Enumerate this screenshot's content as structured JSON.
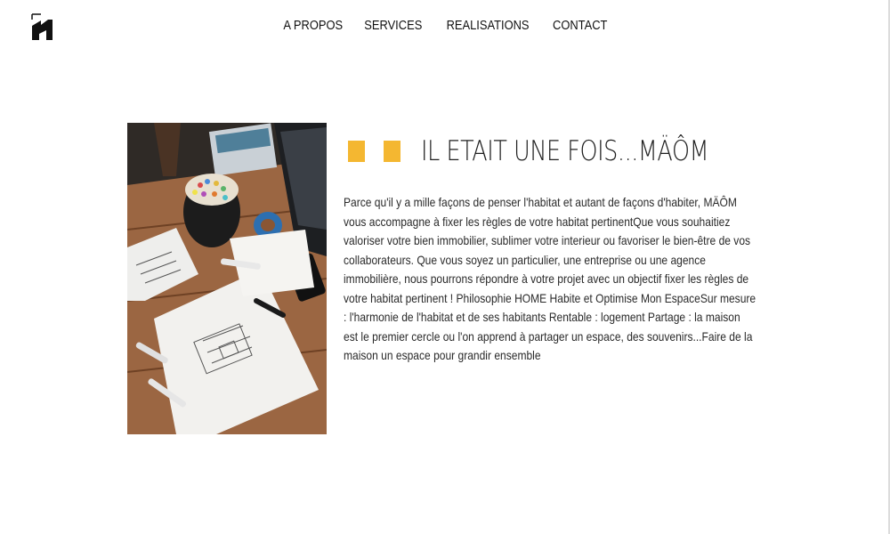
{
  "nav": {
    "items": [
      "A PROPOS",
      "SERVICES",
      "REALISATIONS",
      "CONTACT"
    ]
  },
  "brand": {
    "logo_icon": "maom-logo-icon"
  },
  "section": {
    "title": "IL ETAIT UNE FOIS...MÄÔM",
    "accent_color": "#f4b731",
    "image_icon": "desk-architect-photo",
    "body": "Parce qu'il y a mille façons de penser l'habitat et autant de façons d'habiter, MÄÔM vous accompagne à fixer les règles de votre habitat pertinentQue vous souhaitiez valoriser votre bien immobilier, sublimer votre interieur ou favoriser le bien-être de vos collaborateurs. Que vous soyez un particulier, une entreprise ou une agence immobilière, nous pourrons répondre à votre projet avec un objectif fixer les règles de votre habitat pertinent ! Philosophie HOME Habite et Optimise Mon EspaceSur mesure : l'harmonie de l'habitat et de ses habitants Rentable : logement Partage : la maison est le premier cercle ou l'on apprend à partager un espace, des souvenirs...Faire de la maison un espace pour grandir ensemble"
  }
}
